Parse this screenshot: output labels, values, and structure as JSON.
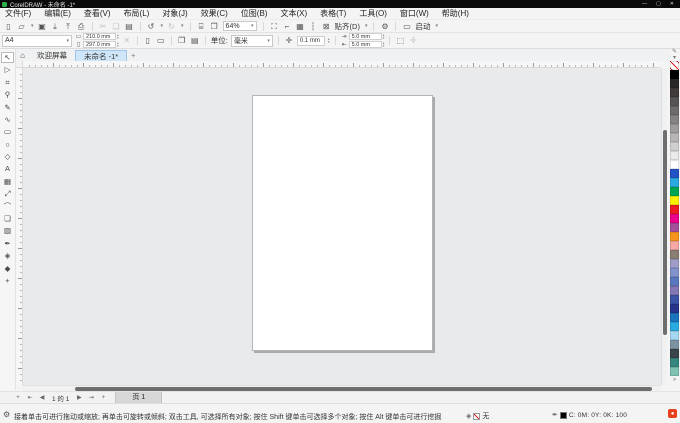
{
  "colors": {
    "logo_green": "#2ab14a",
    "active_tab": "#cfe6f8",
    "outline_swatch": "#000000",
    "corner_icon": "#e8401c"
  },
  "titlebar": {
    "title": "CorelDRAW - 未命名 -1*",
    "minimize": "—",
    "maximize": "▢",
    "close": "✕"
  },
  "menubar": {
    "items": [
      "文件(F)",
      "编辑(E)",
      "查看(V)",
      "布局(L)",
      "对象(J)",
      "效果(C)",
      "位图(B)",
      "文本(X)",
      "表格(T)",
      "工具(O)",
      "窗口(W)",
      "帮助(H)"
    ]
  },
  "toolbar": {
    "icons": {
      "new": "▯",
      "open": "▱",
      "save": "▣",
      "import": "⤓",
      "export": "⤒",
      "print": "⎙",
      "cut": "✂",
      "copy": "❏",
      "paste": "▤",
      "undo": "↺",
      "redo": "↻",
      "search_content": "⌸",
      "zoom_levels": "❐",
      "full_screen": "⛶",
      "show_rulers": "⌐",
      "show_grid": "▦",
      "show_guidelines": "┆",
      "snap_off": "⊠",
      "options_gear": "⚙",
      "launch": "▭"
    },
    "zoom_level": "64%",
    "snap_label": "贴齐(D)",
    "launch_label": "启动"
  },
  "property_bar": {
    "page_size_value": "A4",
    "width_value": "210.0 mm",
    "height_value": "297.0 mm",
    "units_label": "单位:",
    "units_value": "毫米",
    "nudge_value": "0.1 mm",
    "duplicate_x_value": "5.0 mm",
    "duplicate_y_value": "5.0 mm",
    "icons": {
      "page_width": "▭",
      "page_height": "▯",
      "autofit": "✕",
      "portrait": "▯",
      "landscape": "▭",
      "all_pages": "❐",
      "current_page": "▤",
      "nudge": "✛",
      "dup_x": "⇥",
      "dup_y": "⇤",
      "treat_as_filled": "⬚",
      "extra_plus": "✛"
    }
  },
  "document_tabs": {
    "home_icon": "⌂",
    "welcome": "欢迎屏幕",
    "document": "未命名 -1*",
    "new_tab": "+"
  },
  "toolbox": {
    "tools": [
      {
        "name": "pick-tool",
        "glyph": "↖",
        "active": true
      },
      {
        "name": "shape-tool",
        "glyph": "▷"
      },
      {
        "name": "crop-tool",
        "glyph": "⌗"
      },
      {
        "name": "zoom-tool",
        "glyph": "⚲"
      },
      {
        "name": "freehand-tool",
        "glyph": "✎"
      },
      {
        "name": "artistic-media-tool",
        "glyph": "∿"
      },
      {
        "name": "rectangle-tool",
        "glyph": "▭"
      },
      {
        "name": "ellipse-tool",
        "glyph": "○"
      },
      {
        "name": "polygon-tool",
        "glyph": "◇"
      },
      {
        "name": "text-tool",
        "glyph": "A"
      },
      {
        "name": "table-tool",
        "glyph": "▦"
      },
      {
        "name": "parallel-dimension-tool",
        "glyph": "⤢"
      },
      {
        "name": "connector-tool",
        "glyph": "⌒"
      },
      {
        "name": "drop-shadow-tool",
        "glyph": "❏"
      },
      {
        "name": "transparency-tool",
        "glyph": "▨"
      },
      {
        "name": "color-eyedropper-tool",
        "glyph": "✒"
      },
      {
        "name": "smart-fill-tool",
        "glyph": "◈"
      },
      {
        "name": "interactive-fill-tool",
        "glyph": "◆"
      },
      {
        "name": "add-tool-button",
        "glyph": "+"
      }
    ]
  },
  "palette": {
    "option_icon_top": "✎",
    "flyout_icon": "»",
    "colors": [
      "none",
      "#000000",
      "#2b2627",
      "#413b3c",
      "#585354",
      "#6f6b6c",
      "#878384",
      "#9f9c9d",
      "#b8b6b7",
      "#d1d0d0",
      "#eaeaea",
      "#ffffff",
      "#2353c4",
      "#29abe2",
      "#00a651",
      "#fff200",
      "#ed1c24",
      "#ec008c",
      "#a3509c",
      "#f7941d",
      "#f5a8a4",
      "#8b7e72",
      "#9f9cc9",
      "#8193ca",
      "#5a78bd",
      "#8478b4",
      "#3a53a4",
      "#27348b",
      "#1b75bc",
      "#29aae1",
      "#a6d7f2",
      "#7d93a3",
      "#39444b",
      "#38877e",
      "#80c2b2"
    ]
  },
  "page_bar": {
    "add_page": "+",
    "first_page": "⇤",
    "prev_page": "◀",
    "indicator": "1 的 1",
    "next_page": "▶",
    "last_page": "⇥",
    "add_page_end": "+",
    "page_tab": "页 1"
  },
  "status_bar": {
    "gear_icon": "⚙",
    "hint": "接着单击可进行拖动或缩放; 再单击可旋转或倾斜; 双击工具, 可选择所有对象; 按住 Shift 键单击可选择多个对象; 按住 Alt 键单击可进行挖掘",
    "fill_icon": "◈",
    "fill_label": "无",
    "outline_icon": "✒",
    "outline_cmyk": "C: 0M: 0Y: 0K: 100"
  }
}
